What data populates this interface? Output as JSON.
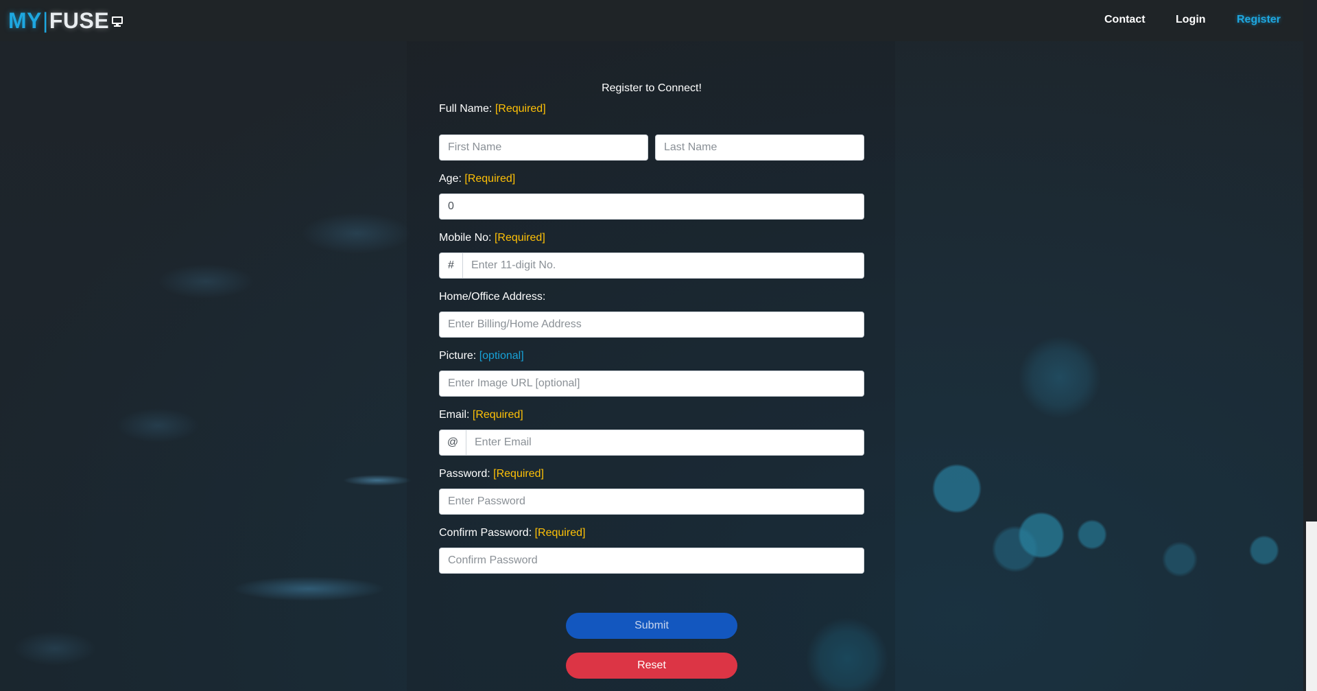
{
  "navbar": {
    "brand_my": "MY",
    "brand_bar": "|",
    "brand_fuse": "FUSE",
    "brand_icon": "monitor-icon",
    "links": {
      "contact": "Contact",
      "login": "Login",
      "register": "Register"
    }
  },
  "form": {
    "title": "Register to Connect!",
    "full_name": {
      "label": "Full Name:",
      "tag": "[Required]",
      "first_placeholder": "First Name",
      "last_placeholder": "Last Name"
    },
    "age": {
      "label": "Age:",
      "tag": "[Required]",
      "value": "0"
    },
    "mobile": {
      "label": "Mobile No:",
      "tag": "[Required]",
      "prefix": "#",
      "placeholder": "Enter 11-digit No."
    },
    "address": {
      "label": "Home/Office Address:",
      "placeholder": "Enter Billing/Home Address"
    },
    "picture": {
      "label": "Picture:",
      "tag": "[optional]",
      "placeholder": "Enter Image URL [optional]"
    },
    "email": {
      "label": "Email:",
      "tag": "[Required]",
      "prefix": "@",
      "placeholder": "Enter Email"
    },
    "password": {
      "label": "Password:",
      "tag": "[Required]",
      "placeholder": "Enter Password"
    },
    "confirm_password": {
      "label": "Confirm Password:",
      "tag": "[Required]",
      "placeholder": "Confirm Password"
    },
    "submit_label": "Submit",
    "reset_label": "Reset"
  },
  "colors": {
    "accent": "#1ea7e0",
    "required": "#ffc107",
    "optional": "#17a2d8",
    "submit": "#1357bf",
    "reset": "#dc3545"
  }
}
